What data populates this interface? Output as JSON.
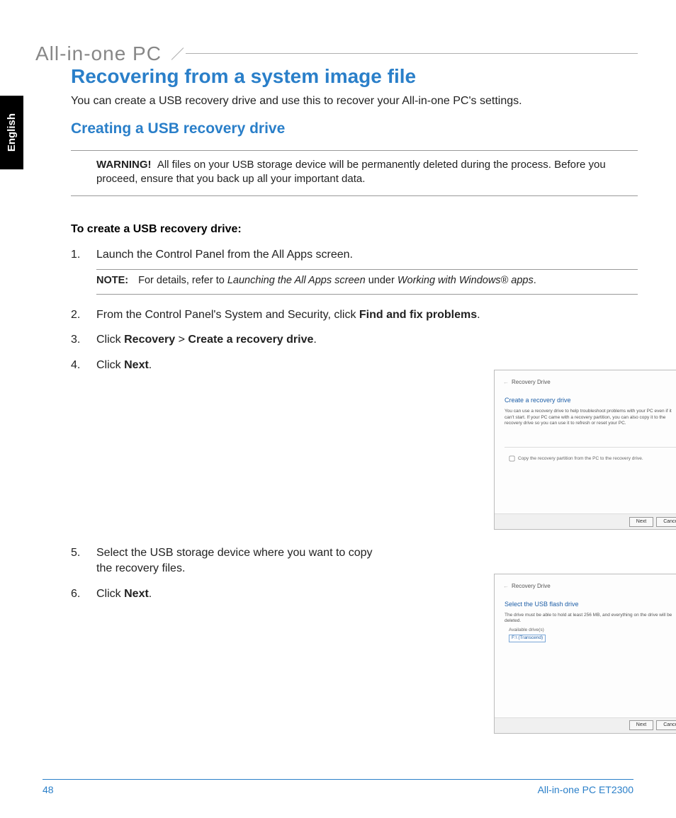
{
  "lang_tab": "English",
  "header": "All-in-one PC",
  "h1": "Recovering from a system image file",
  "intro": "You can create a USB recovery drive and use this to recover your All-in-one PC's settings.",
  "h2": "Creating a USB recovery drive",
  "warning": {
    "label": "WARNING!",
    "text": "All files on your USB storage device will be permanently deleted during the process. Before you proceed, ensure that you back up all your important data."
  },
  "subhead": "To create a USB recovery drive:",
  "steps": {
    "s1": "Launch the Control Panel from the All Apps screen.",
    "note_label": "NOTE:",
    "note_pre": "For details, refer to ",
    "note_em1": "Launching the All Apps screen",
    "note_mid": " under ",
    "note_em2": "Working with Windows® apps",
    "note_post": ".",
    "s2_pre": "From the Control Panel's System and Security, click ",
    "s2_b": "Find and fix problems",
    "s2_post": ".",
    "s3_pre": "Click ",
    "s3_b1": "Recovery",
    "s3_mid": " > ",
    "s3_b2": "Create a recovery drive",
    "s3_post": ".",
    "s4_pre": "Click ",
    "s4_b": "Next",
    "s4_post": ".",
    "s5": "Select the USB storage device where you want to copy the recovery files.",
    "s6_pre": "Click ",
    "s6_b": "Next",
    "s6_post": "."
  },
  "shot1": {
    "title": "Recovery Drive",
    "heading": "Create a recovery drive",
    "body": "You can use a recovery drive to help troubleshoot problems with your PC even if it can't start. If your PC came with a recovery partition, you can also copy it to the recovery drive so you can use it to refresh or reset your PC.",
    "checkbox": "Copy the recovery partition from the PC to the recovery drive.",
    "btn_next": "Next",
    "btn_cancel": "Cancel"
  },
  "shot2": {
    "title": "Recovery Drive",
    "heading": "Select the USB flash drive",
    "body": "The drive must be able to hold at least 256 MB, and everything on the drive will be deleted.",
    "avail_label": "Available drive(s)",
    "drive": "F:\\ (Transcend)",
    "btn_next": "Next",
    "btn_cancel": "Cancel"
  },
  "footer": {
    "page": "48",
    "doc": "All-in-one PC ET2300"
  }
}
